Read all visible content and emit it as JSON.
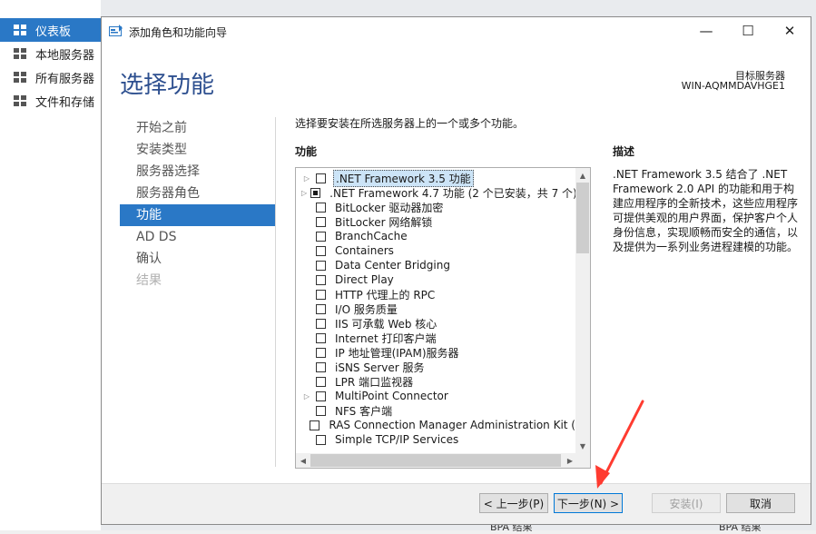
{
  "background": {
    "nav": [
      {
        "label": "仪表板",
        "icon": "dashboard-icon",
        "active": true
      },
      {
        "label": "本地服务器",
        "icon": "server-icon",
        "active": false
      },
      {
        "label": "所有服务器",
        "icon": "servers-icon",
        "active": false
      },
      {
        "label": "文件和存储",
        "icon": "storage-icon",
        "active": false
      }
    ],
    "bottom_text_1": "BPA 结果",
    "bottom_text_2": "BPA 结果"
  },
  "window": {
    "title": "添加角色和功能向导",
    "minimize": "—",
    "maximize": "☐",
    "close": "✕"
  },
  "page_title": "选择功能",
  "destination": {
    "label": "目标服务器",
    "server": "WIN-AQMMDAVHGE1"
  },
  "steps": [
    {
      "label": "开始之前",
      "state": "normal"
    },
    {
      "label": "安装类型",
      "state": "normal"
    },
    {
      "label": "服务器选择",
      "state": "normal"
    },
    {
      "label": "服务器角色",
      "state": "normal"
    },
    {
      "label": "功能",
      "state": "current"
    },
    {
      "label": "AD DS",
      "state": "normal"
    },
    {
      "label": "确认",
      "state": "normal"
    },
    {
      "label": "结果",
      "state": "disabled"
    }
  ],
  "instruction": "选择要安装在所选服务器上的一个或多个功能。",
  "features_heading": "功能",
  "description_heading": "描述",
  "description_text": ".NET Framework 3.5 结合了 .NET Framework 2.0 API 的功能和用于构建应用程序的全新技术，这些应用程序可提供美观的用户界面，保护客户个人身份信息，实现顺畅而安全的通信，以及提供为一系列业务进程建模的功能。",
  "features": [
    {
      "label": ".NET Framework 3.5 功能",
      "expandable": true,
      "state": "unchecked",
      "selected": true
    },
    {
      "label": ".NET Framework 4.7 功能 (2 个已安装，共 7 个)",
      "expandable": true,
      "state": "partial",
      "selected": false
    },
    {
      "label": "BitLocker 驱动器加密",
      "expandable": false,
      "state": "unchecked",
      "selected": false
    },
    {
      "label": "BitLocker 网络解锁",
      "expandable": false,
      "state": "unchecked",
      "selected": false
    },
    {
      "label": "BranchCache",
      "expandable": false,
      "state": "unchecked",
      "selected": false
    },
    {
      "label": "Containers",
      "expandable": false,
      "state": "unchecked",
      "selected": false
    },
    {
      "label": "Data Center Bridging",
      "expandable": false,
      "state": "unchecked",
      "selected": false
    },
    {
      "label": "Direct Play",
      "expandable": false,
      "state": "unchecked",
      "selected": false
    },
    {
      "label": "HTTP 代理上的 RPC",
      "expandable": false,
      "state": "unchecked",
      "selected": false
    },
    {
      "label": "I/O 服务质量",
      "expandable": false,
      "state": "unchecked",
      "selected": false
    },
    {
      "label": "IIS 可承载 Web 核心",
      "expandable": false,
      "state": "unchecked",
      "selected": false
    },
    {
      "label": "Internet 打印客户端",
      "expandable": false,
      "state": "unchecked",
      "selected": false
    },
    {
      "label": "IP 地址管理(IPAM)服务器",
      "expandable": false,
      "state": "unchecked",
      "selected": false
    },
    {
      "label": "iSNS Server 服务",
      "expandable": false,
      "state": "unchecked",
      "selected": false
    },
    {
      "label": "LPR 端口监视器",
      "expandable": false,
      "state": "unchecked",
      "selected": false
    },
    {
      "label": "MultiPoint Connector",
      "expandable": true,
      "state": "unchecked",
      "selected": false
    },
    {
      "label": "NFS 客户端",
      "expandable": false,
      "state": "unchecked",
      "selected": false
    },
    {
      "label": "RAS Connection Manager Administration Kit (",
      "expandable": false,
      "state": "unchecked",
      "selected": false
    },
    {
      "label": "Simple TCP/IP Services",
      "expandable": false,
      "state": "unchecked",
      "selected": false
    }
  ],
  "buttons": {
    "previous": "< 上一步(P)",
    "next": "下一步(N) >",
    "install": "安装(I)",
    "cancel": "取消"
  },
  "colors": {
    "accent": "#2a78c6",
    "title": "#2d4f8f",
    "annotation_arrow": "#ff3b30"
  }
}
